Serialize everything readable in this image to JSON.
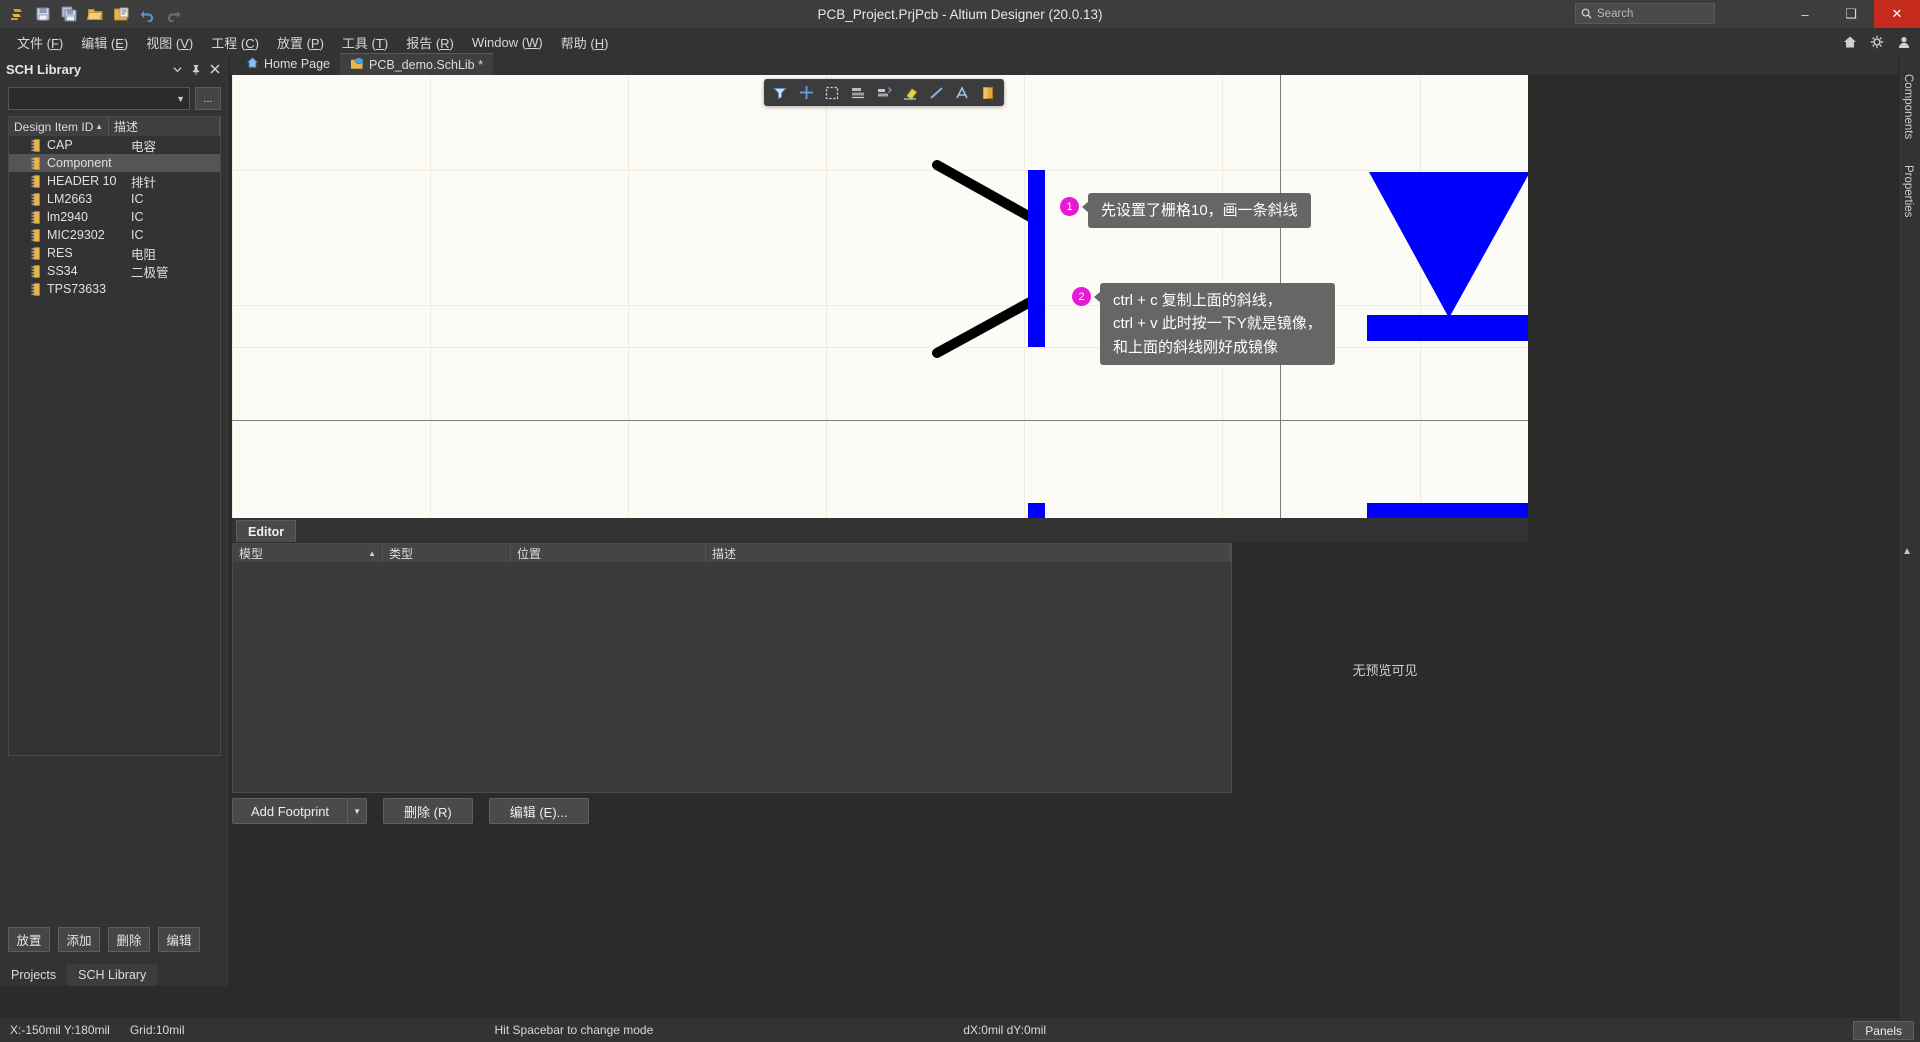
{
  "window": {
    "title": "PCB_Project.PrjPcb - Altium Designer (20.0.13)",
    "search_placeholder": "Search",
    "minimize": "–",
    "maximize": "❑",
    "close": "✕"
  },
  "quick_access": [
    {
      "name": "altium-logo-icon",
      "label": "Altium"
    },
    {
      "name": "save-icon",
      "label": "Save"
    },
    {
      "name": "save-all-icon",
      "label": "Save All"
    },
    {
      "name": "open-icon",
      "label": "Open"
    },
    {
      "name": "open-project-icon",
      "label": "Open Project"
    },
    {
      "name": "undo-icon",
      "label": "Undo"
    },
    {
      "name": "redo-icon",
      "label": "Redo"
    }
  ],
  "menubar": {
    "items": [
      {
        "text": "文件",
        "key": "F"
      },
      {
        "text": "编辑",
        "key": "E"
      },
      {
        "text": "视图",
        "key": "V"
      },
      {
        "text": "工程",
        "key": "C"
      },
      {
        "text": "放置",
        "key": "P"
      },
      {
        "text": "工具",
        "key": "T"
      },
      {
        "text": "报告",
        "key": "R"
      },
      {
        "text": "Window",
        "key": "W"
      },
      {
        "text": "帮助",
        "key": "H"
      }
    ],
    "right_icons": [
      "home-icon",
      "gear-icon",
      "user-icon"
    ]
  },
  "right_vtabs": [
    {
      "label": "Components",
      "name": "vtab-components"
    },
    {
      "label": "Properties",
      "name": "vtab-properties"
    }
  ],
  "sch_library": {
    "title": "SCH Library",
    "header_buttons": [
      "chevron-down-icon",
      "pin-icon",
      "close-icon"
    ],
    "filter_value": "",
    "ellipsis_button": "...",
    "columns": [
      "Design Item ID",
      "描述"
    ],
    "sort_column": 0,
    "sort_arrow": "▲",
    "rows": [
      {
        "id": "CAP",
        "desc": "电容",
        "selected": false
      },
      {
        "id": "Component",
        "desc": "",
        "selected": true
      },
      {
        "id": "HEADER 10",
        "desc": "排针",
        "selected": false
      },
      {
        "id": "LM2663",
        "desc": "IC",
        "selected": false
      },
      {
        "id": "lm2940",
        "desc": "IC",
        "selected": false
      },
      {
        "id": "MIC29302",
        "desc": "IC",
        "selected": false
      },
      {
        "id": "RES",
        "desc": "电阻",
        "selected": false
      },
      {
        "id": "SS34",
        "desc": "二极管",
        "selected": false
      },
      {
        "id": "TPS73633",
        "desc": "",
        "selected": false
      }
    ],
    "buttons": [
      "放置",
      "添加",
      "删除",
      "编辑"
    ],
    "bottom_tabs": [
      {
        "label": "Projects",
        "active": false
      },
      {
        "label": "SCH Library",
        "active": true
      }
    ]
  },
  "doc_tabs": [
    {
      "label": "Home Page",
      "icon": "home-icon",
      "active": false
    },
    {
      "label": "PCB_demo.SchLib *",
      "icon": "schlib-icon",
      "active": true
    }
  ],
  "canvas_toolbar": [
    {
      "name": "filter-icon",
      "label": "Filter"
    },
    {
      "name": "crosshair-icon",
      "label": "Place Part"
    },
    {
      "name": "selection-box-icon",
      "label": "Rectangle Select"
    },
    {
      "name": "align-icon",
      "label": "Align"
    },
    {
      "name": "arrange-icon",
      "label": "Arrange"
    },
    {
      "name": "eraser-icon",
      "label": "Eraser"
    },
    {
      "name": "line-icon",
      "label": "Line"
    },
    {
      "name": "text-icon",
      "label": "Text"
    },
    {
      "name": "color-icon",
      "label": "Color"
    }
  ],
  "annotations": [
    {
      "number": "1",
      "text": "先设置了栅格10，画一条斜线"
    },
    {
      "number": "2",
      "text": "ctrl + c 复制上面的斜线，\nctrl + v 此时按一下Y就是镜像，\n和上面的斜线刚好成镜像"
    }
  ],
  "editor_panel": {
    "tab_label": "Editor",
    "columns": [
      "模型",
      "类型",
      "位置",
      "描述"
    ],
    "sort_arrow": "▲",
    "rows": [],
    "preview_text": "无预览可见"
  },
  "bottom_buttons": {
    "add_footprint": "Add Footprint",
    "dropdown_caret": "▼",
    "delete": "删除 (R)",
    "edit": "编辑 (E)..."
  },
  "statusbar": {
    "coords": "X:-150mil Y:180mil",
    "grid": "Grid:10mil",
    "hint": "Hit Spacebar to change mode",
    "delta": "dX:0mil dY:0mil",
    "panels": "Panels"
  },
  "colors": {
    "accent_blue": "#0000ff",
    "badge_pink": "#e71ad4",
    "bubble_gray": "#666666",
    "chrome": "#333333",
    "canvas_bg": "#fdfbf5",
    "close_red": "#c42b1c"
  }
}
